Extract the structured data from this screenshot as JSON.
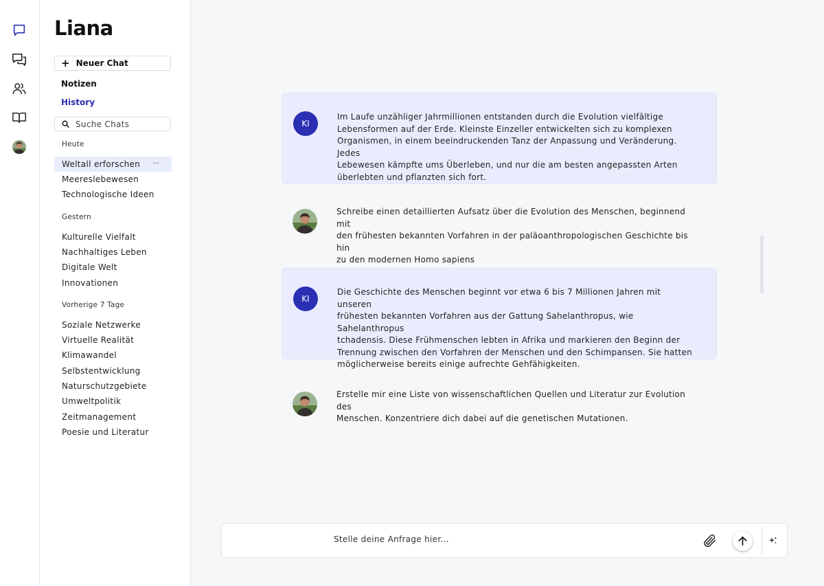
{
  "app": {
    "brand": "Liana",
    "accent_color": "#2a2fb4"
  },
  "rail": {
    "icons": [
      "chat-bubble-icon",
      "chats-icon",
      "users-icon",
      "book-icon",
      "user-avatar"
    ]
  },
  "sidebar": {
    "new_chat_label": "Neuer Chat",
    "notes_label": "Notizen",
    "history_label": "History",
    "search_placeholder": "Suche Chats",
    "groups": [
      {
        "label": "Heute",
        "items": [
          "Weltall erforschen",
          "Meereslebewesen",
          "Technologische Ideen"
        ]
      },
      {
        "label": "Gestern",
        "items": [
          "Kulturelle Vielfalt",
          "Nachhaltiges Leben",
          "Digitale Welt",
          "Innovationen"
        ]
      },
      {
        "label": "Vorherige 7 Tage",
        "items": [
          "Soziale Netzwerke",
          "Virtuelle Realität",
          "Klimawandel",
          "Selbstentwicklung",
          "Naturschutzgebiete",
          "Umweltpolitik",
          "Zeitmanagement",
          "Poesie und Literatur"
        ]
      }
    ],
    "active_item": "Weltall erforschen",
    "item_menu_label": "···"
  },
  "conversation": {
    "messages": [
      {
        "role": "ai",
        "avatar_label": "KI",
        "lines": [
          "Im Laufe unzähliger Jahrmillionen entstanden durch die Evolution vielfältige",
          "Lebensformen auf der Erde. Kleinste Einzeller entwickelten sich zu komplexen",
          "Organismen, in einem beeindruckenden Tanz der Anpassung und Veränderung. Jedes",
          "Lebewesen kämpfte ums Überleben, und nur die am besten angepassten Arten",
          "überlebten und pflanzten sich fort."
        ]
      },
      {
        "role": "user",
        "lines": [
          "Schreibe einen detaillierten Aufsatz über die Evolution des Menschen, beginnend mit",
          "den frühesten bekannten Vorfahren in der paläoanthropologischen Geschichte bis hin",
          "zu den modernen Homo sapiens"
        ]
      },
      {
        "role": "ai",
        "avatar_label": "KI",
        "lines": [
          "Die Geschichte des Menschen beginnt vor etwa 6 bis 7 Millionen Jahren mit unseren",
          "frühesten bekannten Vorfahren aus der Gattung Sahelanthropus, wie Sahelanthropus",
          "tchadensis. Diese Frühmenschen lebten in Afrika und markieren den Beginn der",
          "Trennung zwischen den Vorfahren der Menschen und den Schimpansen. Sie hatten",
          "möglicherweise bereits einige aufrechte Gehfähigkeiten."
        ]
      },
      {
        "role": "user",
        "lines": [
          "Erstelle mir eine Liste von wissenschaftlichen Quellen und Literatur zur Evolution des",
          "Menschen. Konzentriere dich dabei auf die genetischen Mutationen."
        ]
      }
    ]
  },
  "composer": {
    "placeholder": "Stelle deine Anfrage hier...",
    "icons": [
      "paperclip-icon",
      "arrow-up-icon",
      "sparkle-icon"
    ]
  }
}
